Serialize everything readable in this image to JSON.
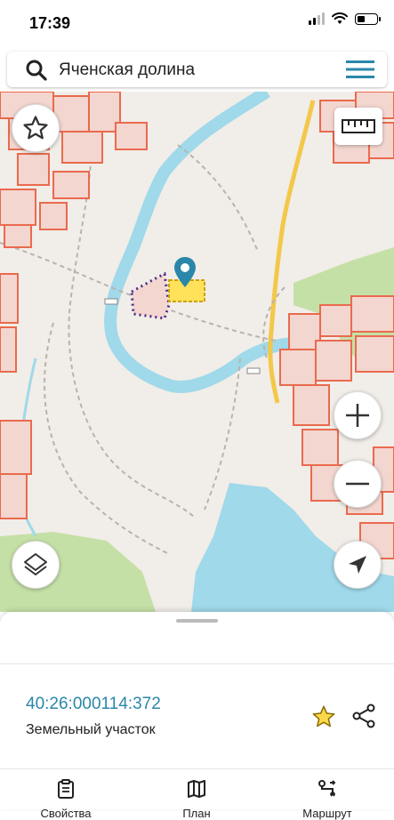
{
  "status_bar": {
    "time": "17:39"
  },
  "search": {
    "query": "Яченская долина"
  },
  "map": {
    "buttons": [
      "favorites-star",
      "ruler",
      "zoom-in",
      "zoom-out",
      "layers",
      "locate"
    ]
  },
  "parcel_card": {
    "cadastral_number": "40:26:000114:372",
    "type": "Земельный участок"
  },
  "tabs": [
    {
      "label": "Свойства",
      "icon": "clipboard-icon"
    },
    {
      "label": "План",
      "icon": "map-icon"
    },
    {
      "label": "Маршрут",
      "icon": "route-icon"
    }
  ],
  "colors": {
    "river": "#9fd9ea",
    "lake": "#9fd9ea",
    "forest": "#c5e0a6",
    "parcels": "#ea6a4e",
    "selected_parcel": "#ffe15a",
    "road": "#f3c84a",
    "link": "#2a87a9"
  }
}
